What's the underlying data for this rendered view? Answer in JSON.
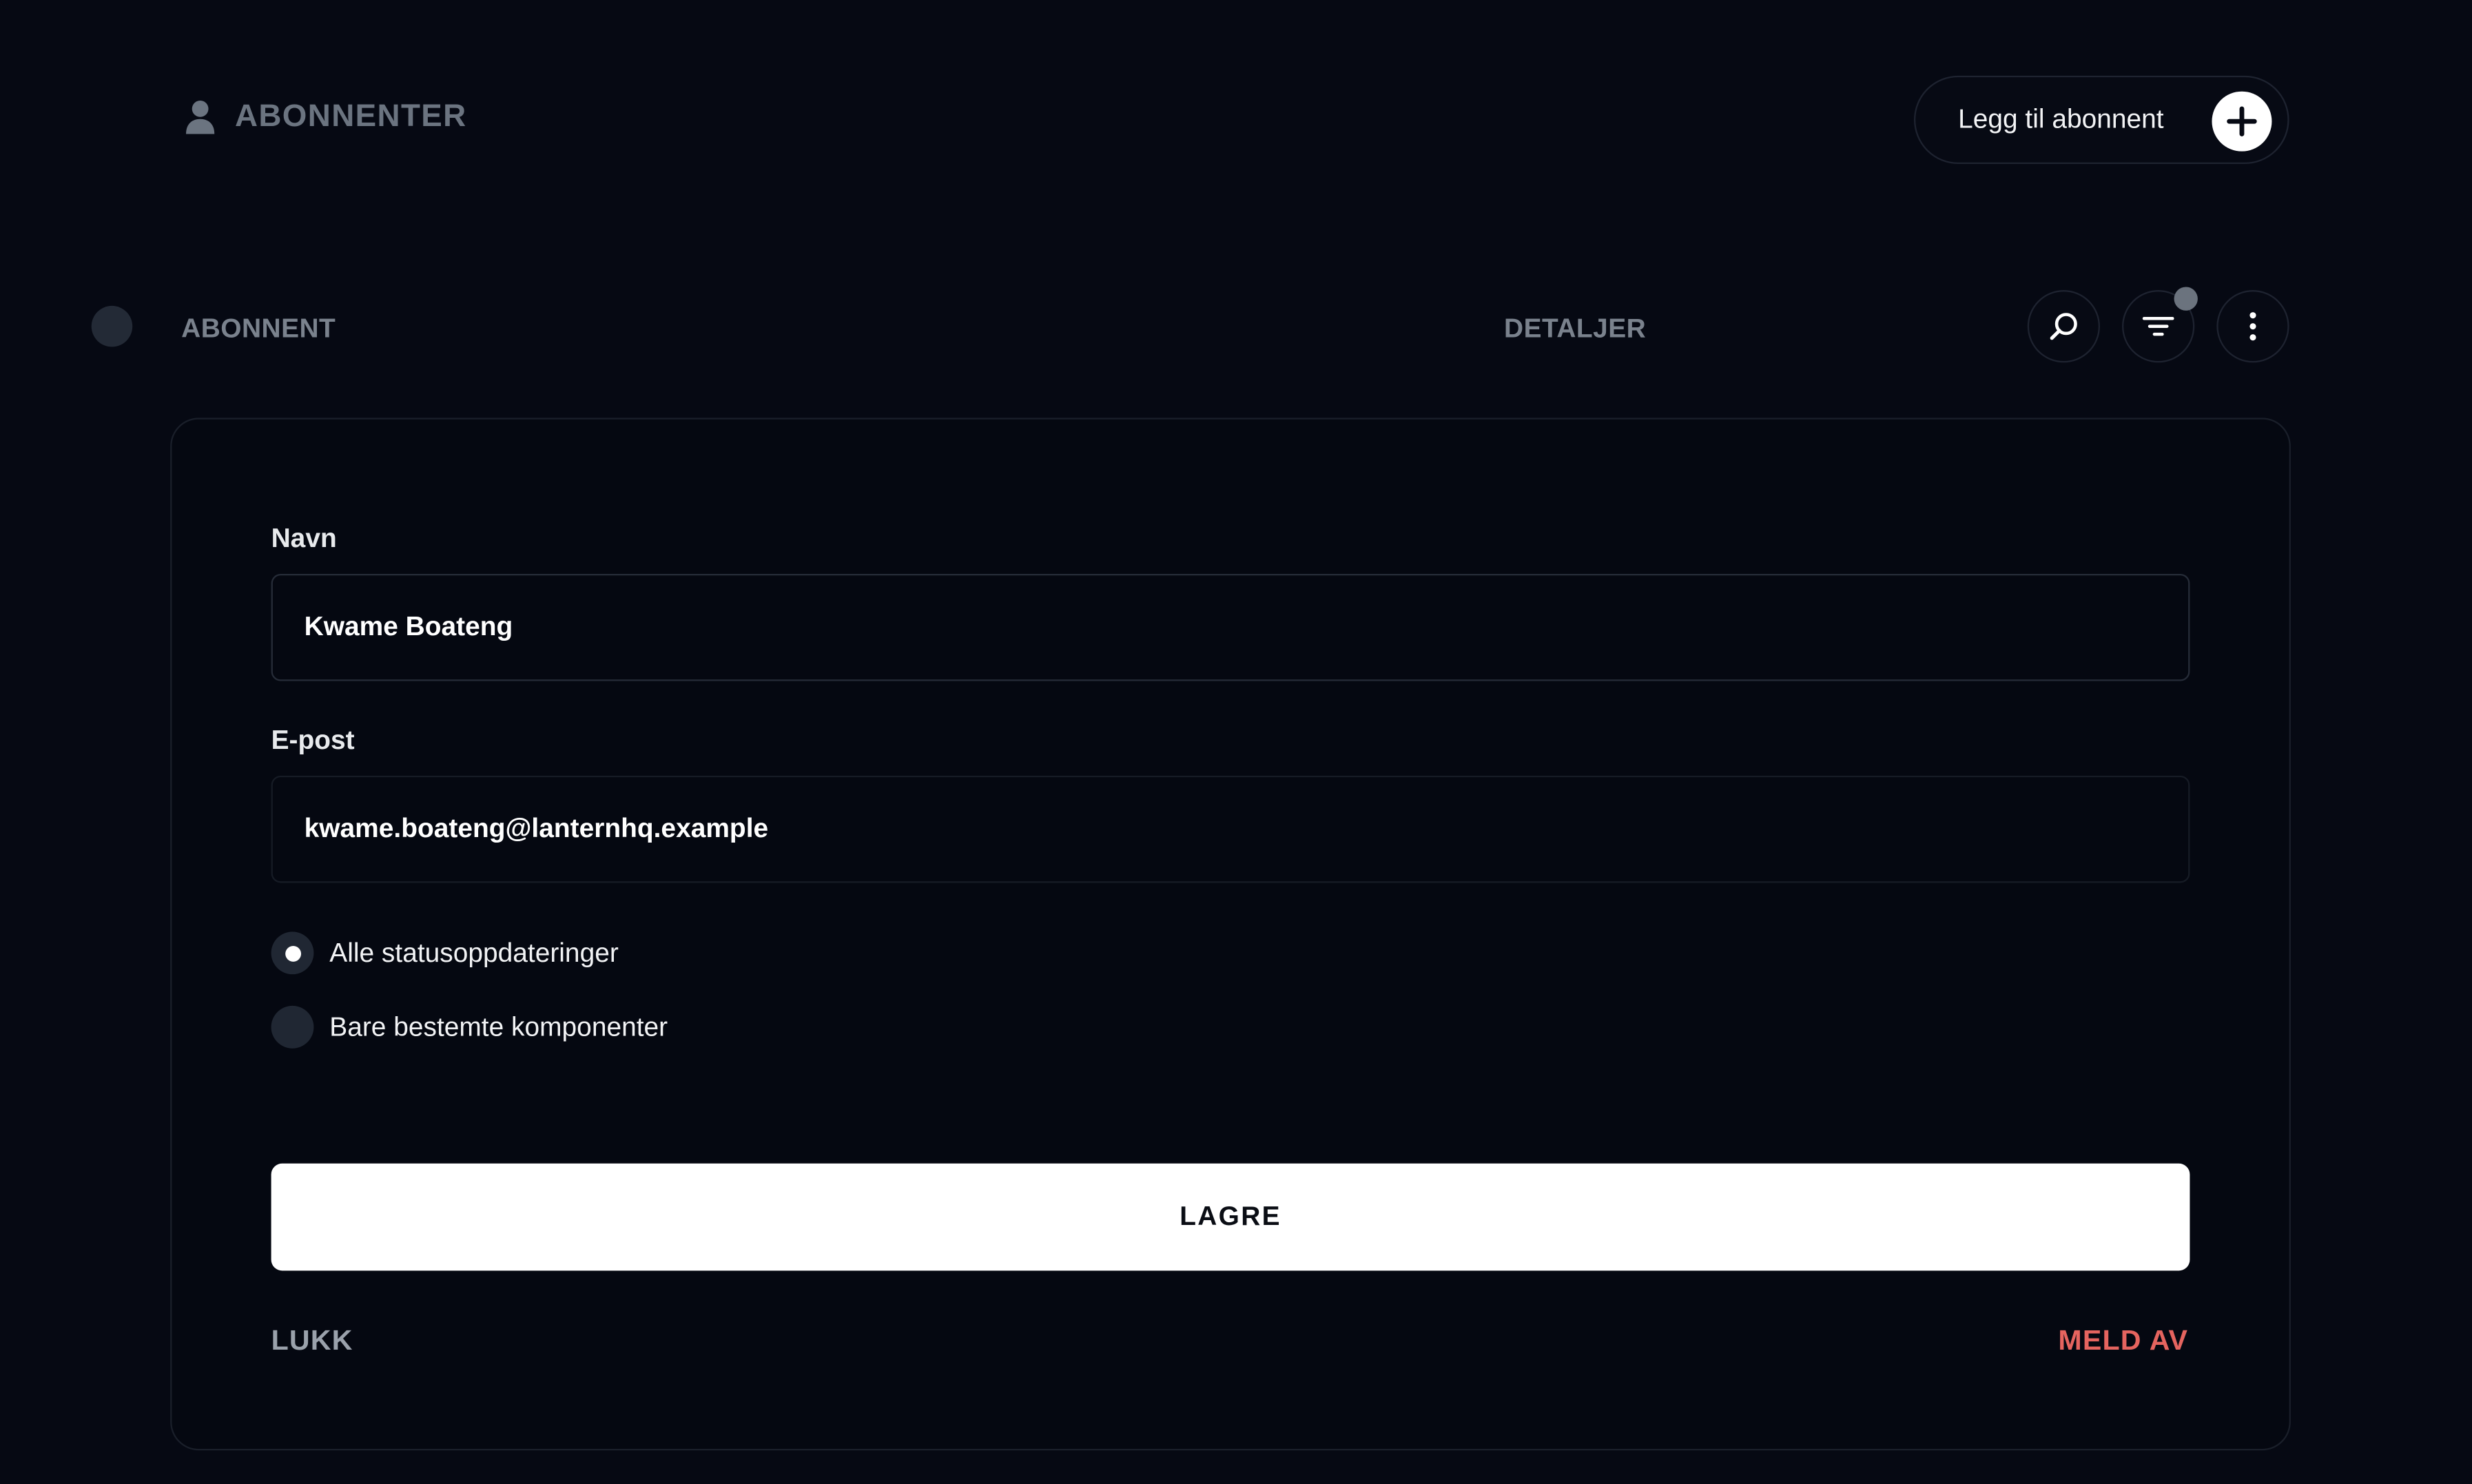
{
  "header": {
    "title": "ABONNENTER",
    "title_icon": "user-icon",
    "add_button_label": "Legg til abonnent",
    "add_button_icon": "plus-circle-icon"
  },
  "table_header": {
    "columns": [
      "ABONNENT",
      "DETALJER"
    ],
    "actions": [
      "search-icon",
      "filter-icon",
      "more-vertical-icon"
    ]
  },
  "form": {
    "name_label": "Navn",
    "name_value": "Kwame Boateng",
    "email_label": "E-post",
    "email_value": "kwame.boateng@lanternhq.example",
    "radio_options": [
      {
        "label": "Alle statusoppdateringer",
        "selected": true
      },
      {
        "label": "Bare bestemte komponenter",
        "selected": false
      }
    ],
    "save_label": "LAGRE",
    "close_label": "LUKK",
    "unsubscribe_label": "MELD AV"
  },
  "colors": {
    "background": "#060913",
    "danger": "#e5645f",
    "muted_text": "#6b7480"
  }
}
